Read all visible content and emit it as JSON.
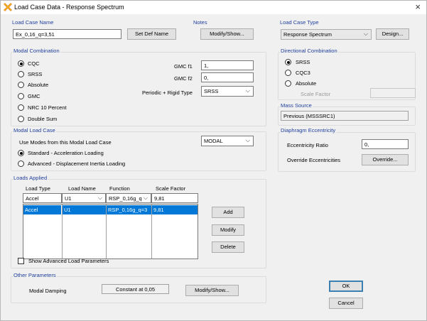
{
  "window": {
    "title": "Load Case Data - Response Spectrum",
    "close_label": "×"
  },
  "load_case_name": {
    "title": "Load Case Name",
    "value": "Ex_0,16_q=3,51",
    "set_def_name": "Set Def Name"
  },
  "notes": {
    "title": "Notes",
    "modify_show": "Modify/Show..."
  },
  "load_case_type": {
    "title": "Load Case Type",
    "value": "Response Spectrum",
    "design": "Design..."
  },
  "modal_combination": {
    "title": "Modal Combination",
    "options": [
      "CQC",
      "SRSS",
      "Absolute",
      "GMC",
      "NRC 10 Percent",
      "Double Sum"
    ],
    "selected": "CQC",
    "gmc_f1_label": "GMC  f1",
    "gmc_f1_value": "1,",
    "gmc_f2_label": "GMC  f2",
    "gmc_f2_value": "0,",
    "periodic_label": "Periodic + Rigid Type",
    "periodic_value": "SRSS"
  },
  "directional_combination": {
    "title": "Directional Combination",
    "options": [
      "SRSS",
      "CQC3",
      "Absolute"
    ],
    "selected": "SRSS",
    "scale_factor_label": "Scale Factor",
    "scale_factor_value": ""
  },
  "mass_source": {
    "title": "Mass Source",
    "value": "Previous  (MSSSRC1)"
  },
  "modal_load_case": {
    "title": "Modal Load Case",
    "use_modes_label": "Use Modes from this Modal Load Case",
    "modal_value": "MODAL",
    "options": [
      "Standard - Acceleration Loading",
      "Advanced - Displacement Inertia Loading"
    ],
    "selected": "Standard - Acceleration Loading"
  },
  "diaphragm": {
    "title": "Diaphragm Eccentricity",
    "ratio_label": "Eccentricity Ratio",
    "ratio_value": "0,",
    "override_label": "Override Eccentricities",
    "override_button": "Override..."
  },
  "loads_applied": {
    "title": "Loads Applied",
    "headers": [
      "Load Type",
      "Load Name",
      "Function",
      "Scale Factor"
    ],
    "edit_row": [
      "Accel",
      "U1",
      "RSP_0,16g_q",
      "9,81"
    ],
    "rows": [
      [
        "Accel",
        "U1",
        "RSP_0,16g_q=3",
        "9,81"
      ]
    ],
    "add": "Add",
    "modify": "Modify",
    "delete": "Delete",
    "show_advanced": "Show Advanced Load Parameters"
  },
  "other_parameters": {
    "title": "Other Parameters",
    "modal_damping_label": "Modal Damping",
    "modal_damping_value": "Constant at 0,05",
    "modify_show": "Modify/Show..."
  },
  "footer": {
    "ok": "OK",
    "cancel": "Cancel"
  },
  "colors": {
    "group_title": "#1f3f9c",
    "selection": "#0078d7"
  }
}
